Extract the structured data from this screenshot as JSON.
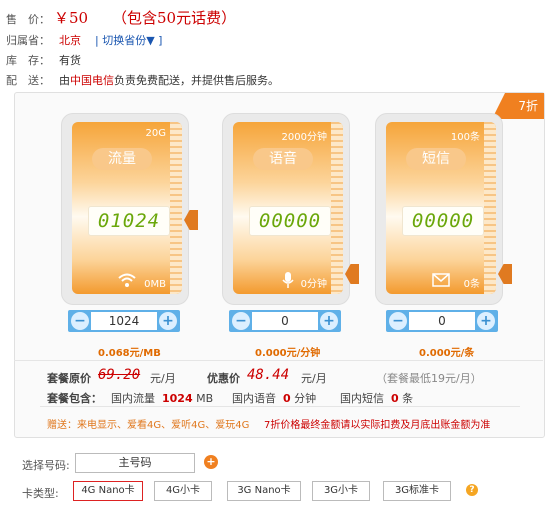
{
  "info": {
    "price_label": "售　价：",
    "price": "￥50",
    "price_note": "（包含50元话费）",
    "region_label": "归属省：",
    "region": "北京",
    "region_switch": "切换省份▼",
    "stock_label": "库　存：",
    "stock": "有货",
    "delivery_label": "配　送：",
    "delivery_pre": "由",
    "delivery_brand": "中国电信",
    "delivery_post": "负责免费配送，并提供售后服务。"
  },
  "badge": "7折",
  "cards": [
    {
      "max": "20G",
      "name": "流量",
      "digits": "01024",
      "min": "0MB",
      "icon": "wifi-icon",
      "value": "1024",
      "rate": "0.068元/MB"
    },
    {
      "max": "2000分钟",
      "name": "语音",
      "digits": "00000",
      "min": "0分钟",
      "icon": "microphone-icon",
      "value": "0",
      "rate": "0.000元/分钟"
    },
    {
      "max": "100条",
      "name": "短信",
      "digits": "00000",
      "min": "0条",
      "icon": "envelope-icon",
      "value": "0",
      "rate": "0.000元/条"
    }
  ],
  "summary": {
    "orig_label": "套餐原价",
    "orig_value": "69.20",
    "orig_unit": "元/月",
    "disc_label": "优惠价",
    "disc_value": "48.44",
    "disc_unit": "元/月",
    "min_note": "（套餐最低19元/月）",
    "incl_label": "套餐包含：",
    "data_label": "国内流量",
    "data_value": "1024",
    "data_unit": "MB",
    "voice_label": "国内语音",
    "voice_value": "0",
    "voice_unit": "分钟",
    "sms_label": "国内短信",
    "sms_value": "0",
    "sms_unit": "条",
    "gift": "赠送：来电显示、爱看4G、爱听4G、爱玩4G",
    "disclaimer": "7折价格最终金额请以实际扣费及月底出账金额为准"
  },
  "number": {
    "label": "选择号码:",
    "value": "主号码",
    "plus": "+"
  },
  "card_type": {
    "label": "卡类型:",
    "options": [
      "4G Nano卡",
      "4G小卡",
      "3G Nano卡",
      "3G小卡",
      "3G标准卡"
    ],
    "help": "?"
  },
  "colors": {
    "accent": "#f08020",
    "price": "#cc0000",
    "digits": "#6aa70a",
    "stepper": "#5fb0e8"
  }
}
